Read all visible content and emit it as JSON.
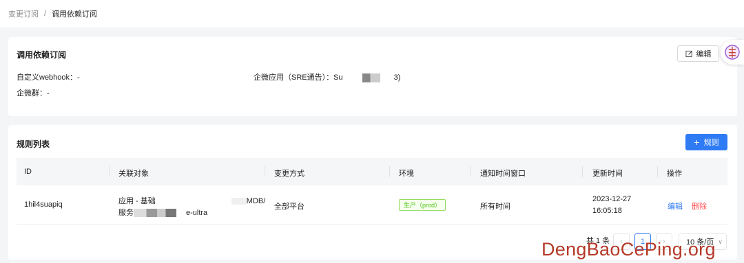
{
  "breadcrumb": {
    "prev": "变更订阅",
    "separator": "/",
    "current": "调用依赖订阅"
  },
  "info_card": {
    "title": "调用依赖订阅",
    "edit_label": "编辑",
    "webhook": "自定义webhook：-",
    "wechat_app_prefix": "企微应用（SRE通告）：Su",
    "wechat_app_suffix": "3)",
    "wechat_group": "企微群：-"
  },
  "rules_card": {
    "title": "规则列表",
    "add_label": "规则",
    "columns": [
      "ID",
      "关联对象",
      "变更方式",
      "环境",
      "通知时间窗口",
      "更新时间",
      "操作"
    ],
    "rows": [
      {
        "id": "1hil4suapiq",
        "object_line1_prefix": "应用 - 基础",
        "object_line1_suffix": "MDB/",
        "object_line2_prefix": "服务",
        "object_line2_suffix": "e-ultra",
        "change_method": "全部平台",
        "env": "生产（prod）",
        "window": "所有时间",
        "updated_date": "2023-12-27",
        "updated_time": "16:05:18",
        "action_edit": "编辑",
        "action_delete": "删除"
      }
    ]
  },
  "pagination": {
    "total": "共 1 条",
    "current_page": "1",
    "prev": "‹",
    "next": "›",
    "page_size": "10 条/页"
  },
  "colors": {
    "primary": "#2f7bf5",
    "danger": "#ff4d4f",
    "success": "#52c41a"
  },
  "watermark": "DengBaoCePing.org"
}
